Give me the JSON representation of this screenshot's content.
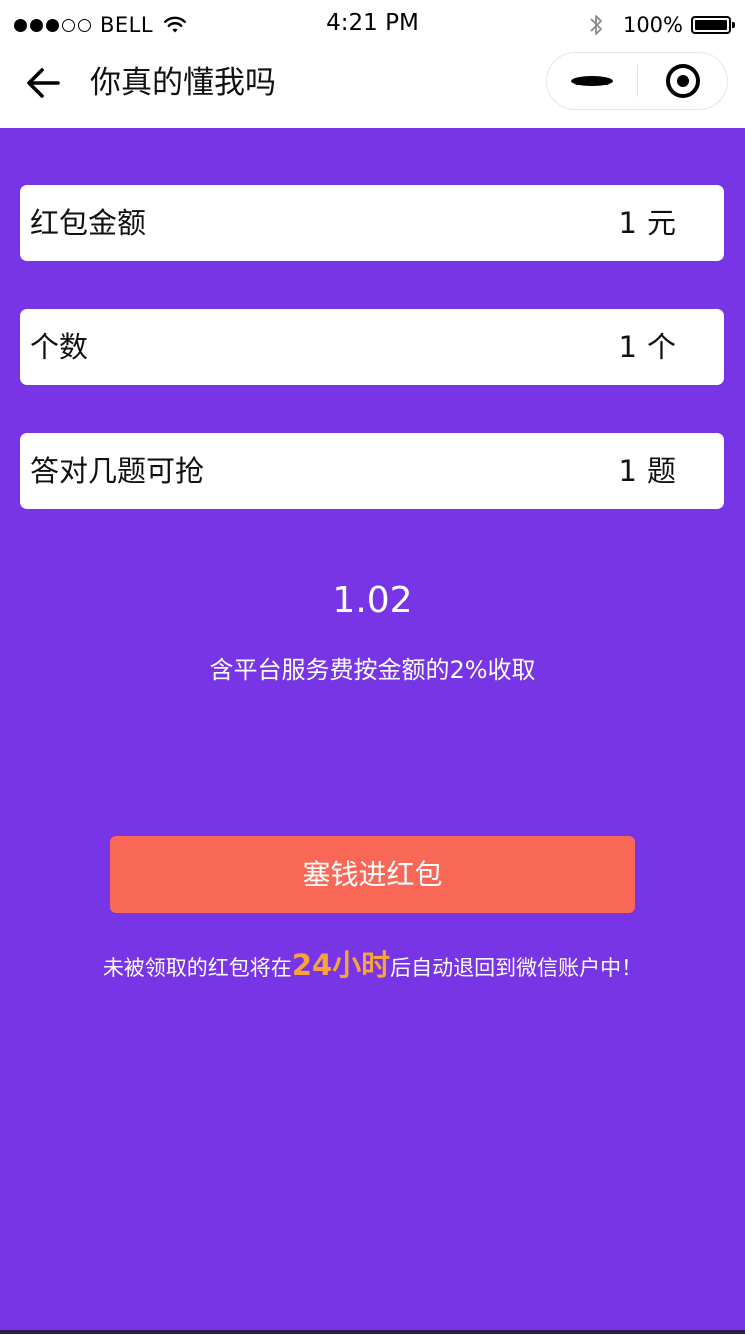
{
  "status_bar": {
    "carrier": "BELL",
    "time": "4:21 PM",
    "battery": "100%",
    "signal_icon": "signal-dots-icon",
    "wifi_icon": "wifi-icon",
    "bluetooth_icon": "bluetooth-icon",
    "battery_icon": "battery-icon"
  },
  "nav": {
    "title": "你真的懂我吗",
    "back_icon": "arrow-left-icon",
    "more_icon": "more-dots-icon",
    "close_icon": "target-circle-icon"
  },
  "form": {
    "fields": [
      {
        "label": "红包金额",
        "value": "1",
        "unit": "元"
      },
      {
        "label": "个数",
        "value": "1",
        "unit": "个"
      },
      {
        "label": "答对几题可抢",
        "value": "1",
        "unit": "题"
      }
    ]
  },
  "summary": {
    "total": "1.02",
    "fee_note": "含平台服务费按金额的2%收取"
  },
  "submit_label": "塞钱进红包",
  "refund_note": {
    "before": "未被领取的红包将在",
    "highlight": "24小时",
    "after": "后自动退回到微信账户中！"
  },
  "colors": {
    "background": "#7735e5",
    "button": "#f96857",
    "highlight": "#f6a33b"
  }
}
